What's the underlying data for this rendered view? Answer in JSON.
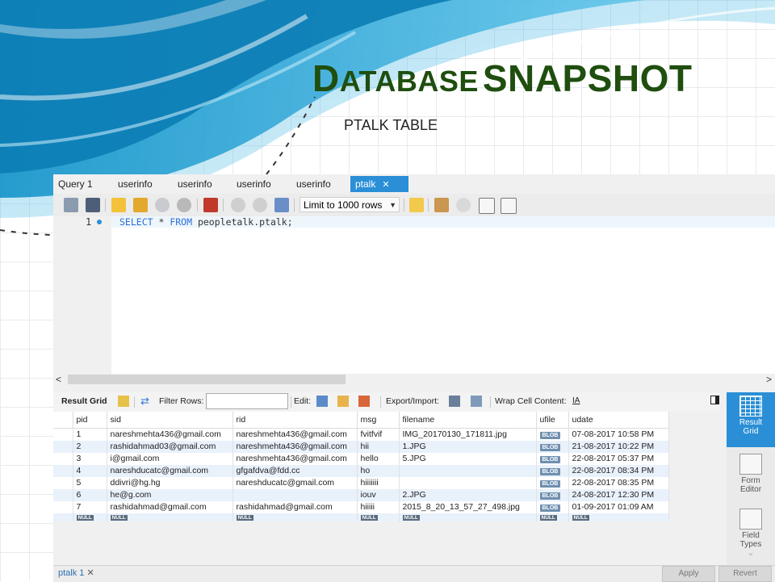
{
  "slide": {
    "title_first": "D",
    "title_rest": "ATABASE",
    "title_second": "SNAPSHOT",
    "subtitle": "PTALK TABLE"
  },
  "tabs": [
    {
      "label": "Query 1",
      "active": false
    },
    {
      "label": "userinfo",
      "active": false
    },
    {
      "label": "userinfo",
      "active": false
    },
    {
      "label": "userinfo",
      "active": false
    },
    {
      "label": "userinfo",
      "active": false
    },
    {
      "label": "ptalk",
      "active": true
    }
  ],
  "toolbar": {
    "limit_label": "Limit to 1000 rows",
    "icons": [
      "open-folder-icon",
      "save-icon",
      "execute-icon",
      "execute-current-icon",
      "explain-icon",
      "stop-icon",
      "toggle-error-icon",
      "commit-icon",
      "rollback-icon",
      "autocommit-icon",
      "star-icon",
      "beautify-icon",
      "find-icon",
      "invisibles-icon",
      "wrap-icon"
    ]
  },
  "editor": {
    "line_number": "1",
    "kw_select": "SELECT",
    "star": " * ",
    "kw_from": "FROM",
    "table_ref": " peopletalk.ptalk;"
  },
  "result_toolbar": {
    "result_grid": "Result Grid",
    "filter_rows": "Filter Rows:",
    "edit": "Edit:",
    "export_import": "Export/Import:",
    "wrap_cell": "Wrap Cell Content:"
  },
  "results": {
    "columns": [
      "pid",
      "sid",
      "rid",
      "msg",
      "filename",
      "ufile",
      "udate"
    ],
    "rows": [
      [
        "1",
        "nareshmehta436@gmail.com",
        "nareshmehta436@gmail.com",
        "fvitfvif",
        "IMG_20170130_171811.jpg",
        "BLOB",
        "07-08-2017 10:58 PM"
      ],
      [
        "2",
        "rashidahmad03@gmail.com",
        "nareshmehta436@gmail.com",
        "hii",
        "1.JPG",
        "BLOB",
        "21-08-2017 10:22 PM"
      ],
      [
        "3",
        "i@gmail.com",
        "nareshmehta436@gmail.com",
        "hello",
        "5.JPG",
        "BLOB",
        "22-08-2017 05:37 PM"
      ],
      [
        "4",
        "nareshducatc@gmail.com",
        "gfgafdva@fdd.cc",
        "ho",
        "",
        "BLOB",
        "22-08-2017 08:34 PM"
      ],
      [
        "5",
        "ddivri@hg.hg",
        "nareshducatc@gmail.com",
        "hiiiiiii",
        "",
        "BLOB",
        "22-08-2017 08:35 PM"
      ],
      [
        "6",
        "he@g.com",
        "",
        "iouv",
        "2.JPG",
        "BLOB",
        "24-08-2017 12:30 PM"
      ],
      [
        "7",
        "rashidahmad@gmail.com",
        "rashidahmad@gmail.com",
        "hiiiii",
        "2015_8_20_13_57_27_498.jpg",
        "BLOB",
        "01-09-2017 01:09 AM"
      ]
    ],
    "null_label": "NULL"
  },
  "side_panel": {
    "result_grid": [
      "Result",
      "Grid"
    ],
    "form_editor": [
      "Form",
      "Editor"
    ],
    "field_types": [
      "Field",
      "Types"
    ]
  },
  "bottom": {
    "tab_label": "ptalk 1",
    "apply": "Apply",
    "revert": "Revert"
  },
  "colors": {
    "title": "#1f4e0f",
    "accent_blue": "#2a8fd6",
    "alt_row": "#e9f1fb"
  }
}
